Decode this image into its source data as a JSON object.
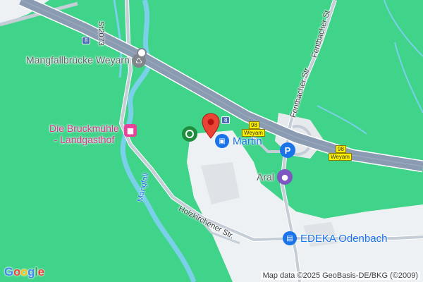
{
  "map": {
    "colors": {
      "land": "#3fd489",
      "urban": "#eef1f3",
      "highway": "#8a9bb2",
      "road": "#c5cdd6",
      "water": "#7ad0e8",
      "pin": "#ea4335"
    },
    "labels": {
      "bridge": "Mangfallbrücke Weyarn",
      "inn_line1": "Die Bruckmühle",
      "inn_line2": "- Landgasthof",
      "martin": "Martin",
      "aral": "Aral",
      "edeka": "EDEKA Odenbach",
      "st2073": "St2073",
      "fentbacher_1": "Fentbacher Str.",
      "fentbacher_2": "Fentbacher St",
      "holzkirchener": "Holzkirchener Str.",
      "mangfall": "Mangfall",
      "shield_98_a": "98",
      "shield_weyarn_a": "Weyam",
      "shield_98_b": "98",
      "shield_weyarn_b": "Weyam",
      "autobahn_a": "8",
      "autobahn_b": "8",
      "parking": "P"
    },
    "icons": {
      "bridge": "monument-icon",
      "inn": "bed-icon",
      "martin": "shopping-bag-icon",
      "aral": "gas-station-icon",
      "edeka": "shopping-cart-icon",
      "parking": "parking-icon",
      "green_poi": "green-place-icon",
      "pin": "location-pin-icon"
    }
  },
  "footer": {
    "logo_letters": [
      "G",
      "o",
      "o",
      "g",
      "l",
      "e"
    ],
    "attribution": "Map data ©2025 GeoBasis-DE/BKG (©2009)"
  }
}
